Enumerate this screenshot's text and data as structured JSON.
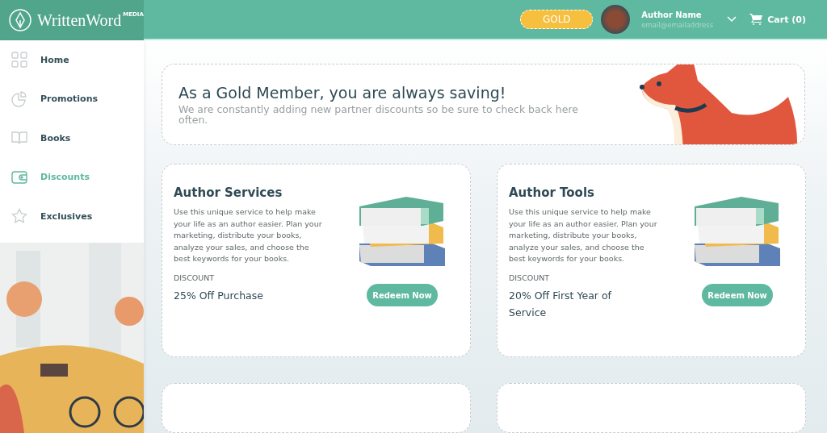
{
  "brand": {
    "name": "WrittenWord",
    "tag": "MEDIA"
  },
  "header": {
    "membership": "GOLD",
    "user_name": "Author Name",
    "user_email": "email@emailaddress",
    "cart": "Cart (0)"
  },
  "sidebar": {
    "items": [
      {
        "label": "Home",
        "selected": false
      },
      {
        "label": "Promotions",
        "selected": false
      },
      {
        "label": "Books",
        "selected": false
      },
      {
        "label": "Discounts",
        "selected": true
      },
      {
        "label": "Exclusives",
        "selected": false
      }
    ]
  },
  "hero": {
    "title": "As a Gold Member, you are always saving!",
    "subtitle": "We are constantly adding new partner discounts so be sure to check back here often."
  },
  "offers": [
    {
      "title": "Author Services",
      "description": "Use this unique service to help make your life as an author easier. Plan your marketing, distribute your books, analyze your sales, and choose the best keywords for your books.",
      "discount_label": "DISCOUNT",
      "discount": "25% Off Purchase",
      "button": "Redeem Now"
    },
    {
      "title": "Author Tools",
      "description": "Use this unique service to help make your life as an author easier. Plan your marketing, distribute your books, analyze your sales, and choose the best keywords for your books.",
      "discount_label": "DISCOUNT",
      "discount": "20% Off First Year of Service",
      "button": "Redeem Now"
    }
  ]
}
